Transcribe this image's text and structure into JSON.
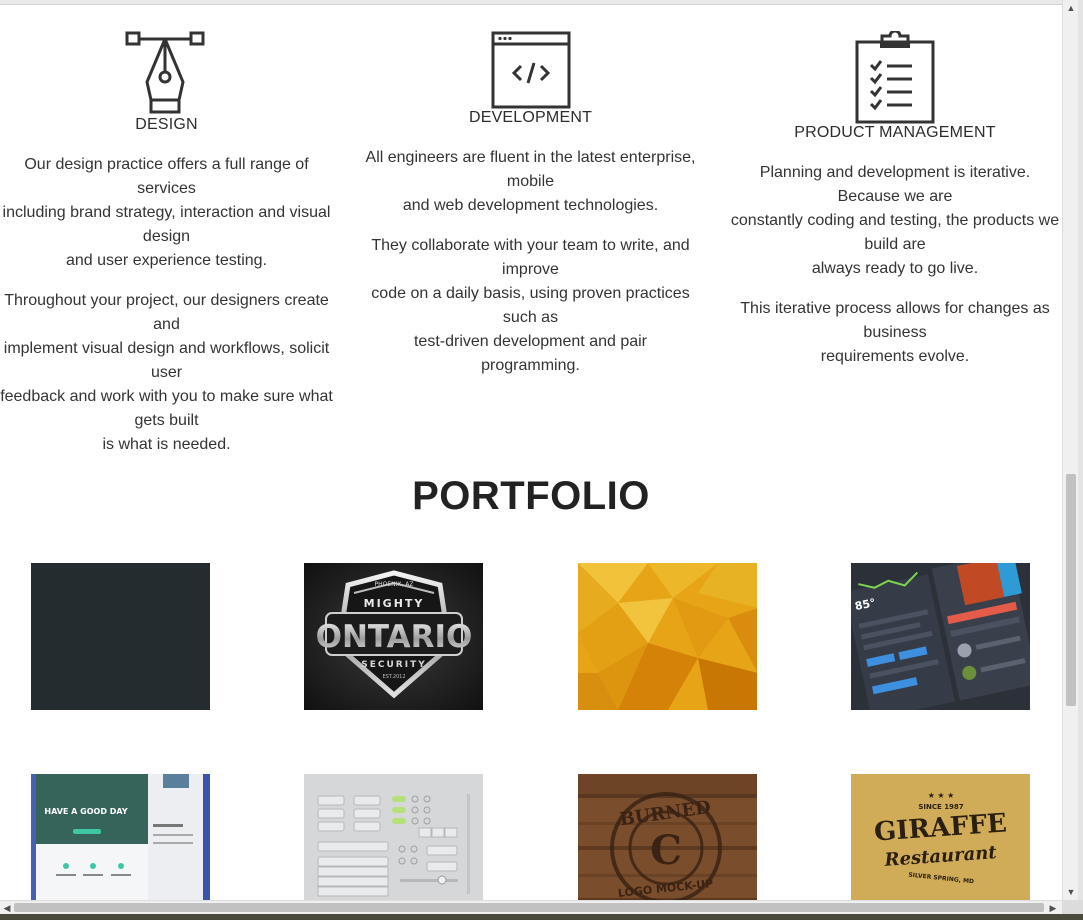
{
  "services": [
    {
      "title": "DESIGN",
      "icon": "pen-nib-icon",
      "paragraphs": [
        [
          "Our design practice offers a full range of",
          "services",
          "including brand strategy, interaction and visual",
          "design",
          "and user experience testing."
        ],
        [
          "Throughout your project, our designers create",
          "and",
          "implement visual design and workflows, solicit",
          "user",
          "feedback and work with you to make sure what",
          "gets built",
          "is what is needed."
        ]
      ]
    },
    {
      "title": "DEVELOPMENT",
      "icon": "code-window-icon",
      "paragraphs": [
        [
          "All engineers are fluent in the latest enterprise,",
          "mobile",
          "and web development technologies."
        ],
        [
          "They collaborate with your team to write, and",
          "improve",
          "code on a daily basis, using proven practices",
          "such as",
          "test-driven development and pair",
          "programming."
        ]
      ]
    },
    {
      "title": "PRODUCT MANAGEMENT",
      "icon": "clipboard-checklist-icon",
      "paragraphs": [
        [
          "Planning and development is iterative.",
          "Because we are",
          "constantly coding and testing, the products we",
          "build are",
          "always ready to go live."
        ],
        [
          "This iterative process allows for changes as",
          "business",
          "requirements evolve."
        ]
      ]
    }
  ],
  "portfolio": {
    "heading": "PORTFOLIO",
    "items": [
      {
        "name": "dark-slate",
        "label": ""
      },
      {
        "name": "mighty-ontario",
        "label": "MIGHTY ONTARIO SECURITY"
      },
      {
        "name": "golden-polygon",
        "label": ""
      },
      {
        "name": "dashboard-ui",
        "label": ""
      },
      {
        "name": "have-a-good-day",
        "label": "HAVE A GOOD DAY"
      },
      {
        "name": "ui-kit",
        "label": ""
      },
      {
        "name": "burned-logo",
        "label": "BURNED LOGO MOCK-UP"
      },
      {
        "name": "giraffe-restaurant",
        "label": "GIRAFFE Restaurant"
      }
    ],
    "badge_text": {
      "ontario_top": "PHOENIX, AZ",
      "ontario_mid": "MIGHTY",
      "ontario_main": "ONTARIO",
      "ontario_sub": "SECURITY",
      "ontario_est": "EST.2012",
      "good_day": "HAVE A GOOD DAY",
      "burned_top": "BURNED",
      "burned_mid": "C",
      "burned_bottom": "LOGO MOCK-UP",
      "giraffe_since": "SINCE 1987",
      "giraffe_main": "GIRAFFE",
      "giraffe_script": "Restaurant",
      "giraffe_loc": "SILVER SPRING, MD"
    }
  }
}
